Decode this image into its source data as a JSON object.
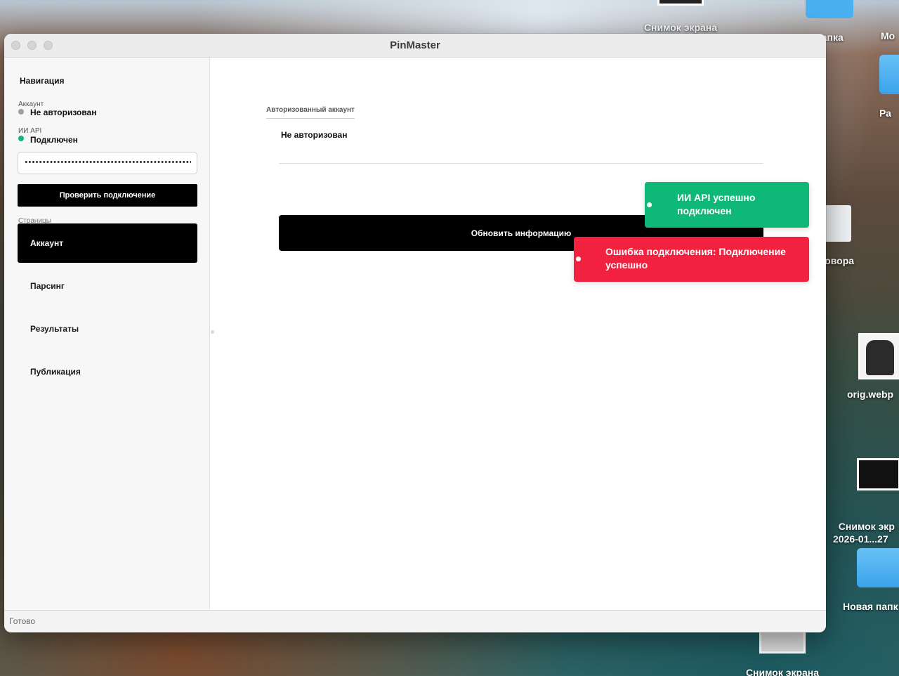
{
  "desktop": {
    "icons": [
      {
        "label": "Снимок экрана"
      },
      {
        "label": "папка"
      },
      {
        "label": "Мо"
      },
      {
        "label": "Ра"
      },
      {
        "label": "оговора"
      },
      {
        "label": "orig.webp"
      },
      {
        "label": "Снимок экр\n2026-01...27"
      },
      {
        "label": "Новая папк"
      },
      {
        "label": "Снимок экрана"
      }
    ]
  },
  "window": {
    "title": "PinMaster"
  },
  "sidebar": {
    "title": "Навигация",
    "account_label": "Аккаунт",
    "account_status": "Не авторизован",
    "account_status_color": "#9aa0a6",
    "api_label": "ИИ API",
    "api_status": "Подключен",
    "api_status_color": "#0fb877",
    "api_key_value": "••••••••••••••••••••••••••••••••••••••••••••••••••••••",
    "check_button": "Проверить подключение",
    "pages_label": "Страницы",
    "pages": [
      {
        "label": "Аккаунт",
        "active": true
      },
      {
        "label": "Парсинг",
        "active": false
      },
      {
        "label": "Результаты",
        "active": false
      },
      {
        "label": "Публикация",
        "active": false
      }
    ]
  },
  "main": {
    "account_label": "Авторизованный аккаунт",
    "account_value": "Не авторизован",
    "refresh_button": "Обновить информацию"
  },
  "status_bar": {
    "text": "Готово"
  },
  "toasts": {
    "success": {
      "text": "ИИ API успешно подключен",
      "color": "#0fb877"
    },
    "error": {
      "text": "Ошибка подключения: Подключение успешно",
      "color": "#f2213f"
    }
  }
}
